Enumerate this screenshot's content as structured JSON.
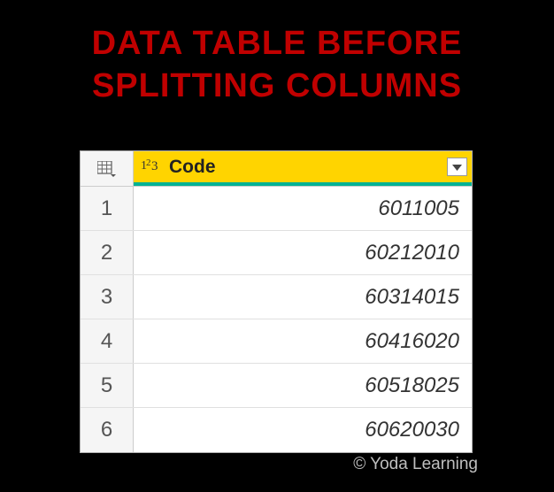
{
  "title_line1": "DATA TABLE BEFORE",
  "title_line2": "SPLITTING COLUMNS",
  "column": {
    "type_label": "1²3",
    "name": "Code"
  },
  "rows": [
    {
      "num": "1",
      "value": "6011005"
    },
    {
      "num": "2",
      "value": "60212010"
    },
    {
      "num": "3",
      "value": "60314015"
    },
    {
      "num": "4",
      "value": "60416020"
    },
    {
      "num": "5",
      "value": "60518025"
    },
    {
      "num": "6",
      "value": "60620030"
    }
  ],
  "credit": "© Yoda Learning"
}
